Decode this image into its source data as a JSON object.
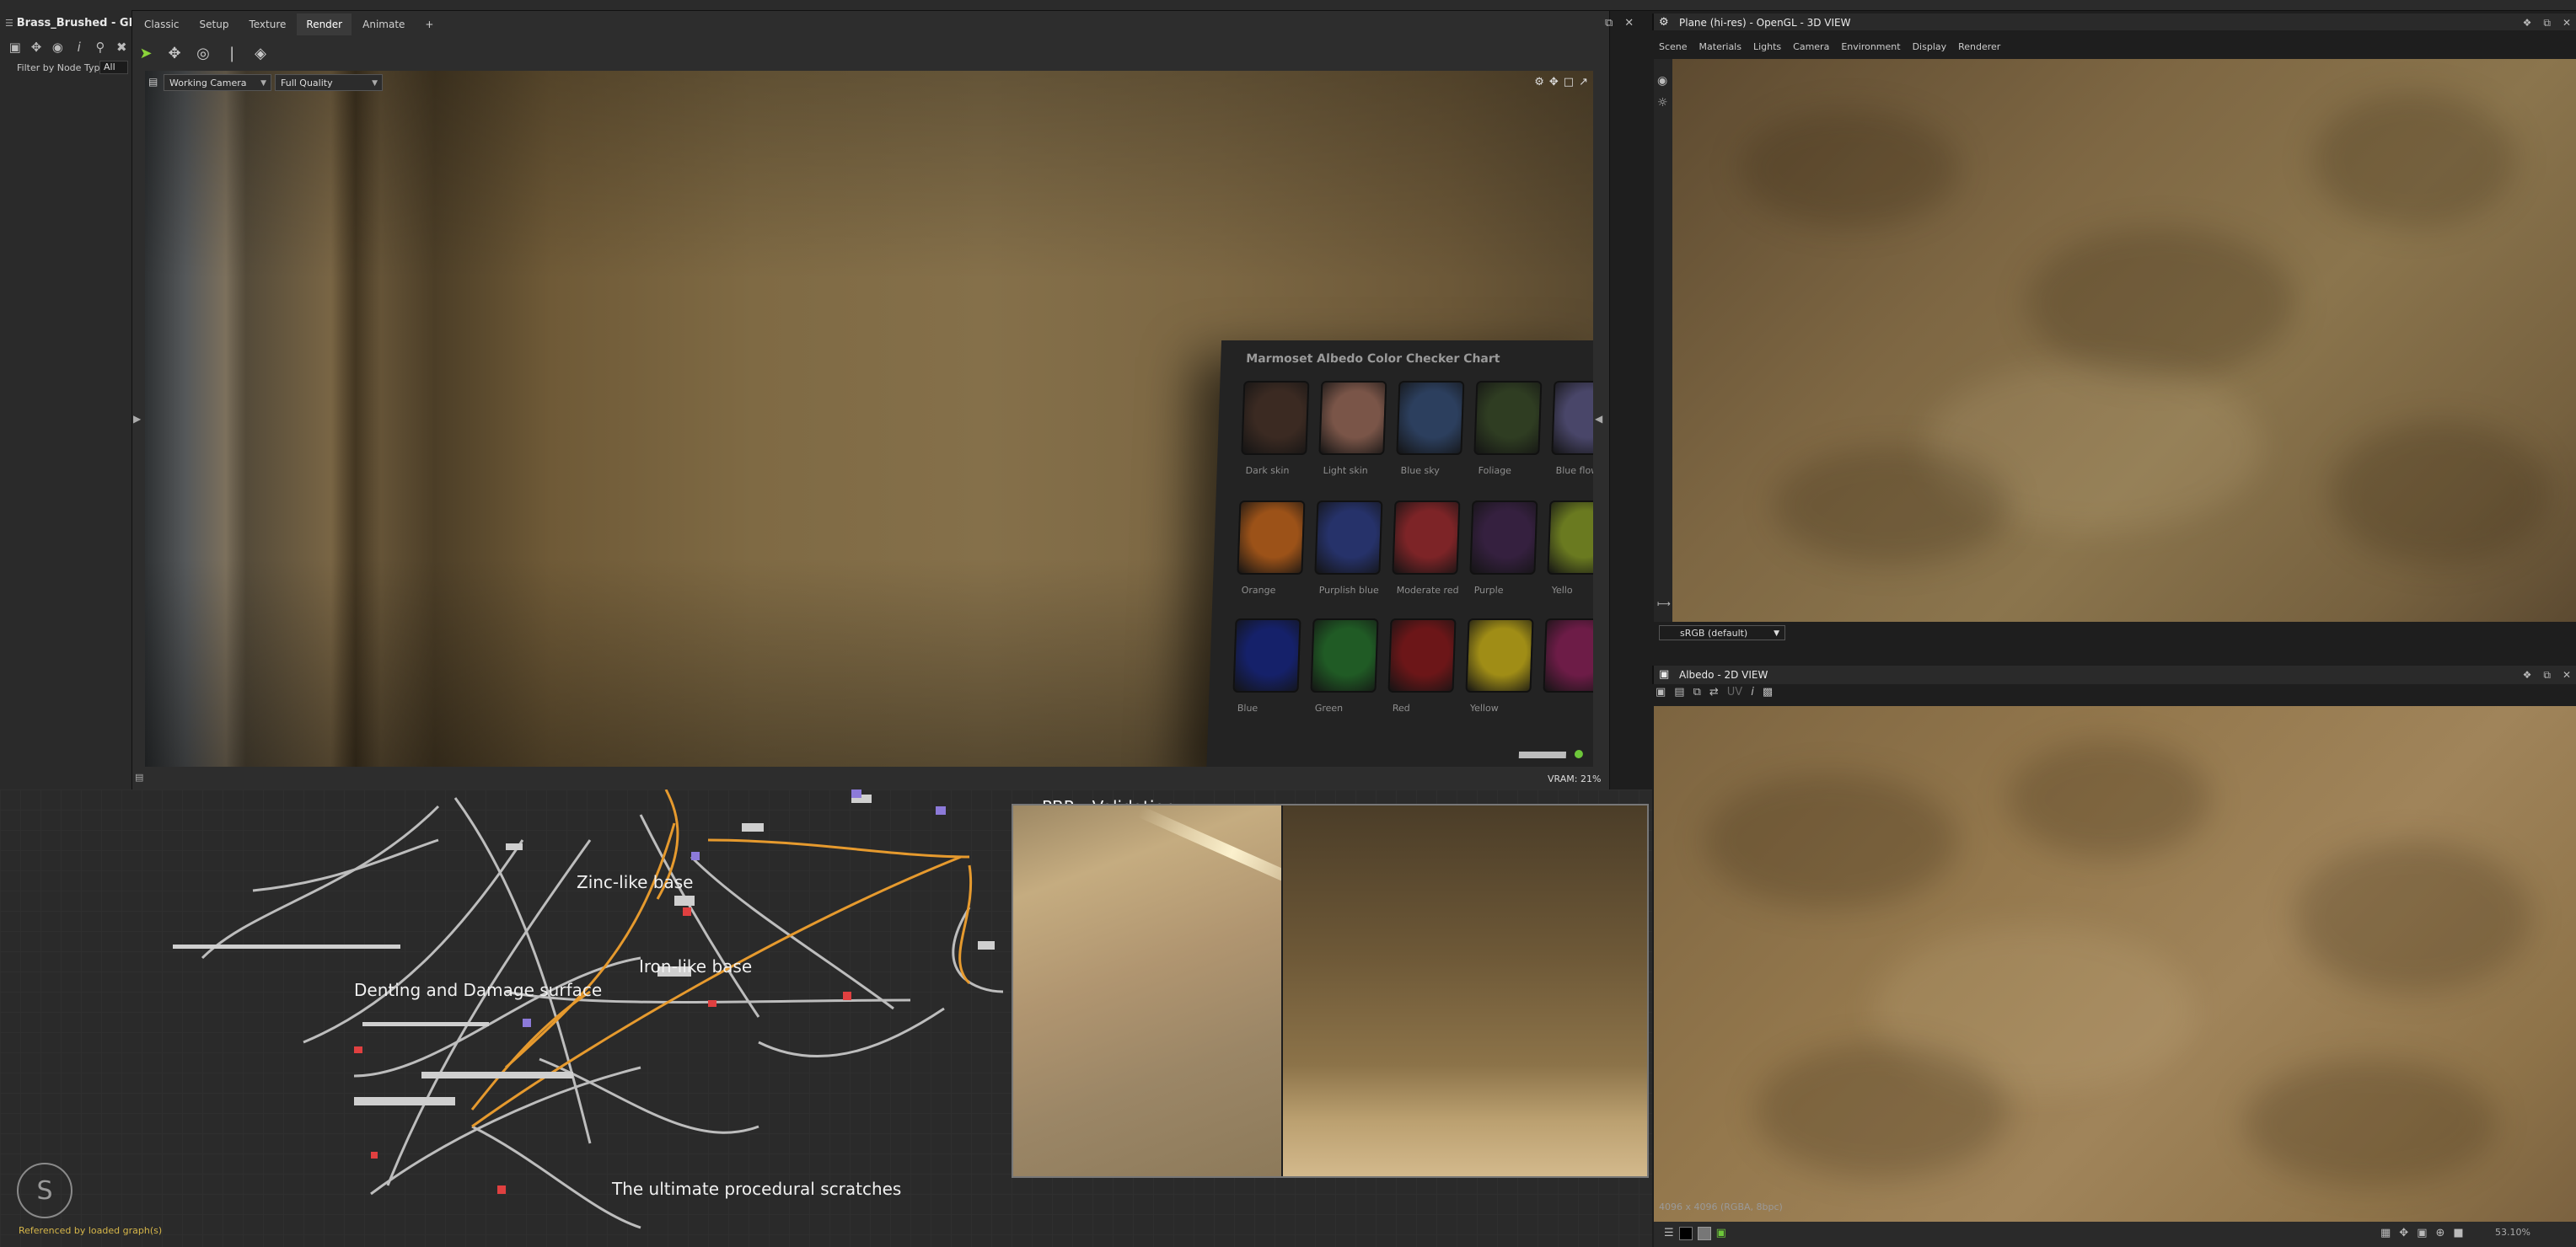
{
  "window": {
    "title": "Brass_Brushed - GR"
  },
  "left_panel": {
    "filter_label": "Filter by Node Type",
    "filter_value": "All"
  },
  "editor": {
    "tabs": [
      "Classic",
      "Setup",
      "Texture",
      "Render",
      "Animate",
      "+"
    ],
    "active_tab": "Render",
    "camera_select": "Working Camera",
    "quality_select": "Full Quality",
    "vram": "VRAM: 21%"
  },
  "checker_chart": {
    "title": "Marmoset Albedo Color Checker Chart",
    "row1_labels": [
      "Dark skin",
      "Light skin",
      "Blue sky",
      "Foliage",
      "Blue flowe"
    ],
    "row2_labels": [
      "Orange",
      "Purplish blue",
      "Moderate red",
      "Purple",
      "Yello"
    ],
    "row3_labels": [
      "Blue",
      "Green",
      "Red",
      "Yellow"
    ],
    "colors": {
      "row1": [
        "#3b2a22",
        "#7a5548",
        "#2c3f5e",
        "#2f3d22",
        "#494669"
      ],
      "row2": [
        "#9c5218",
        "#26326a",
        "#7d2427",
        "#35203f",
        "#6a7a20"
      ],
      "row3": [
        "#15216a",
        "#205b25",
        "#6c1618",
        "#a08d16",
        "#6d1c47"
      ]
    }
  },
  "graph": {
    "frames": [
      "Zinc-like base",
      "Iron-like base",
      "Denting and Damage surface",
      "The ultimate procedural scratches"
    ],
    "pbr_title": "PBR - Validation",
    "status": "Referenced by loaded graph(s)"
  },
  "view3d": {
    "title": "Plane (hi-res) - OpenGL - 3D VIEW",
    "menu": [
      "Scene",
      "Materials",
      "Lights",
      "Camera",
      "Environment",
      "Display",
      "Renderer"
    ],
    "colorspace": "sRGB (default)"
  },
  "view2d": {
    "title": "Albedo - 2D VIEW",
    "resolution": "4096 x 4096 (RGBA, 8bpc)",
    "zoom": "53.10%"
  },
  "colors": {
    "accent_orange": "#e69a2e",
    "link_grey": "#bdbdbd",
    "status_yellow": "#d6b64a"
  }
}
